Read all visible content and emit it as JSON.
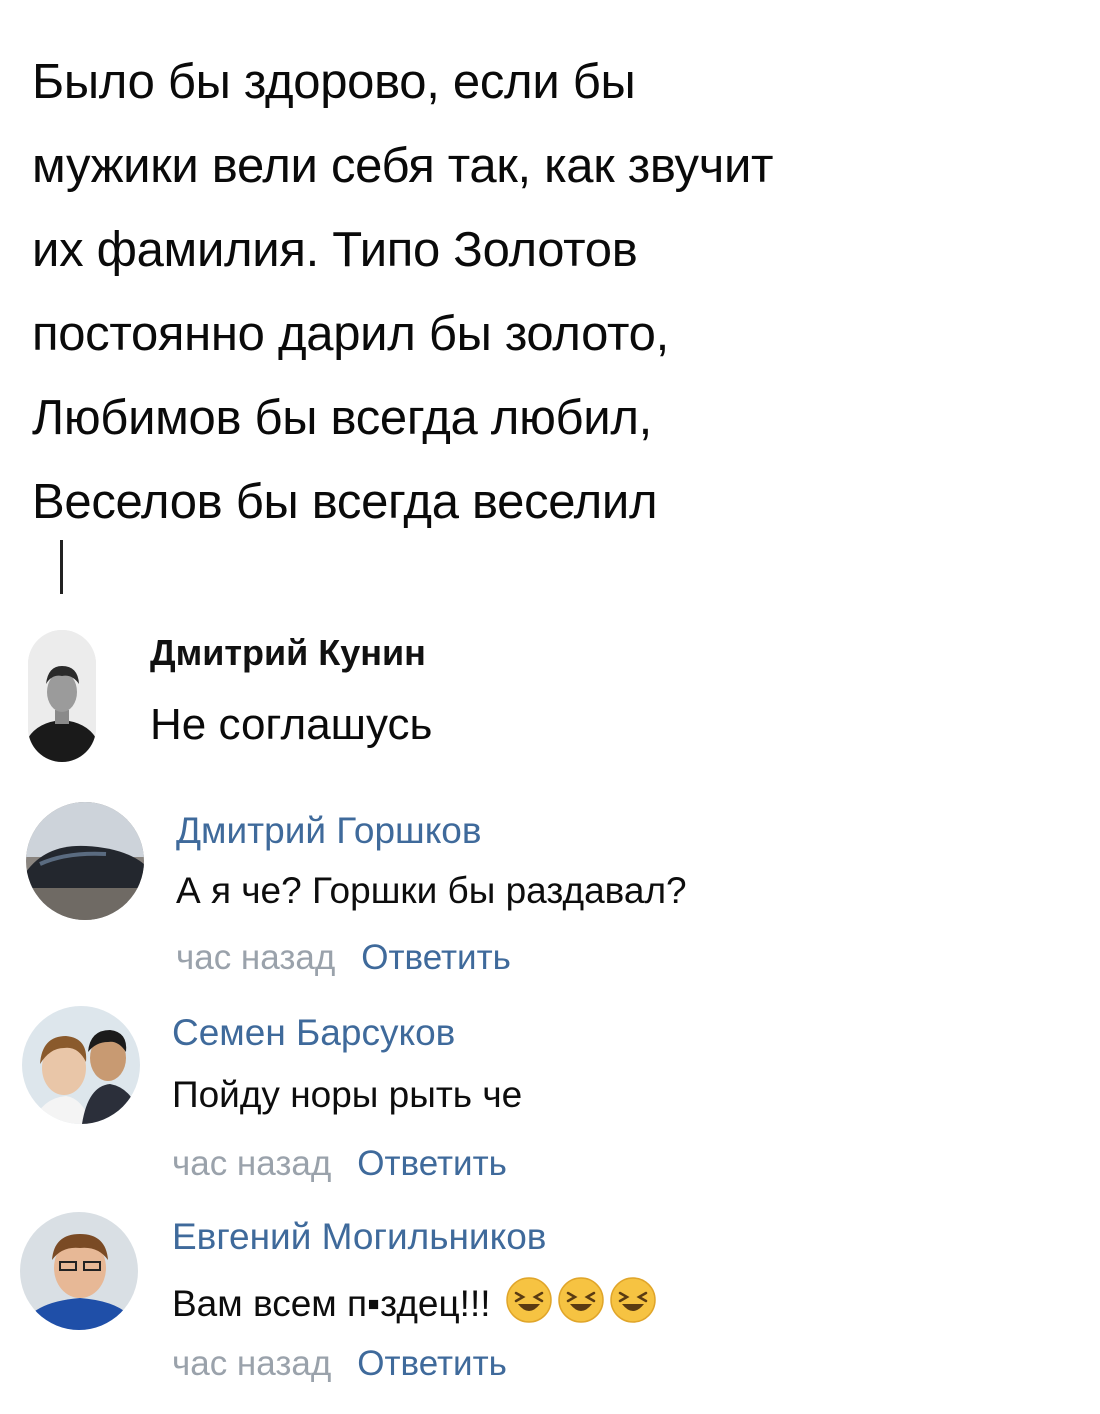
{
  "post": {
    "lines": [
      "Было бы здорово, если бы",
      "мужики вели себя так, как звучит",
      "их фамилия. Типо Золотов",
      "постоянно дарил бы золото,",
      "Любимов бы всегда любил,",
      "Веселов бы всегда веселил"
    ]
  },
  "comment": {
    "author": "Дмитрий Кунин",
    "text": "Не соглашусь"
  },
  "replies": [
    {
      "author": "Дмитрий Горшков",
      "text": "А я че? Горшки бы раздавал?",
      "time": "час назад",
      "reply_label": "Ответить"
    },
    {
      "author": "Семен Барсуков",
      "text": "Пойду норы рыть че",
      "time": "час назад",
      "reply_label": "Ответить"
    },
    {
      "author": "Евгений Могильников",
      "text": "Вам всем п▪здец!!!",
      "time": "час назад",
      "reply_label": "Ответить",
      "emoji_count": 3
    }
  ],
  "colors": {
    "link": "#3f6a9b",
    "muted": "#9aa2ab"
  }
}
